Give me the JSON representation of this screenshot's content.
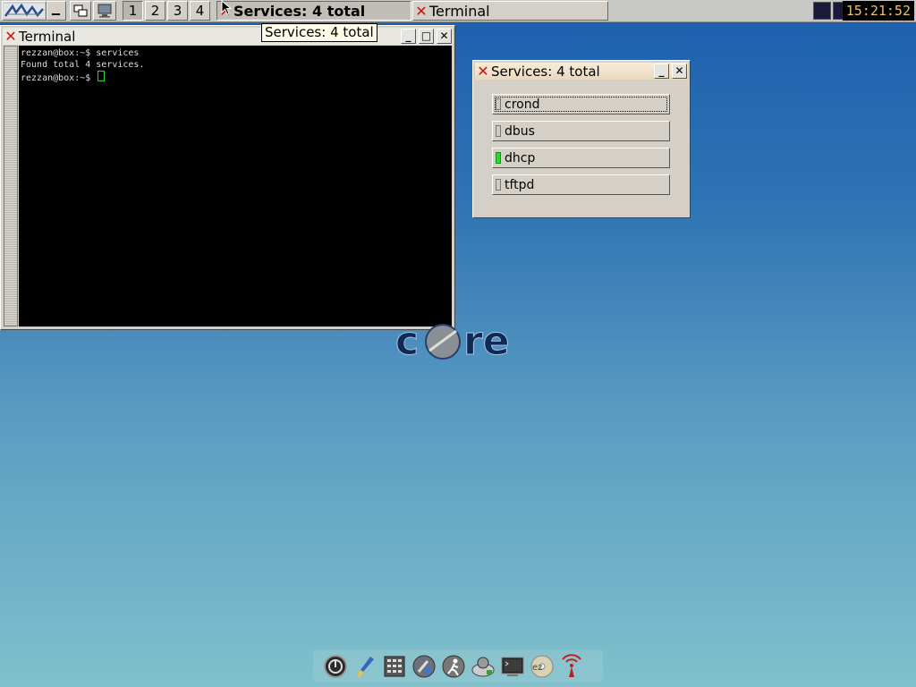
{
  "taskbar": {
    "workspaces": [
      "1",
      "2",
      "3",
      "4"
    ],
    "active_workspace": "1",
    "tasks": [
      {
        "title": "Services: 4 total",
        "active": true
      },
      {
        "title": "Terminal",
        "active": false
      }
    ],
    "clock": "15:21:52"
  },
  "tooltip": {
    "text": "Services: 4 total"
  },
  "terminal_window": {
    "title": "Terminal",
    "lines": [
      "rezzan@box:~$ services",
      "Found total 4 services.",
      "rezzan@box:~$ "
    ]
  },
  "services_window": {
    "title": "Services: 4 total",
    "services": [
      {
        "name": "crond",
        "running": false,
        "focused": true
      },
      {
        "name": "dbus",
        "running": false,
        "focused": false
      },
      {
        "name": "dhcp",
        "running": true,
        "focused": false
      },
      {
        "name": "tftpd",
        "running": false,
        "focused": false
      }
    ]
  },
  "dock": {
    "icons": [
      "power-icon",
      "paintbrush-icon",
      "calculator-icon",
      "wrench-icon",
      "runner-icon",
      "apps-icon",
      "terminal-icon",
      "ezremaster-icon",
      "wifi-icon"
    ]
  },
  "colors": {
    "running_led": "#2fd62f",
    "close_x": "#d01010",
    "clock_text": "#e7c46a"
  }
}
